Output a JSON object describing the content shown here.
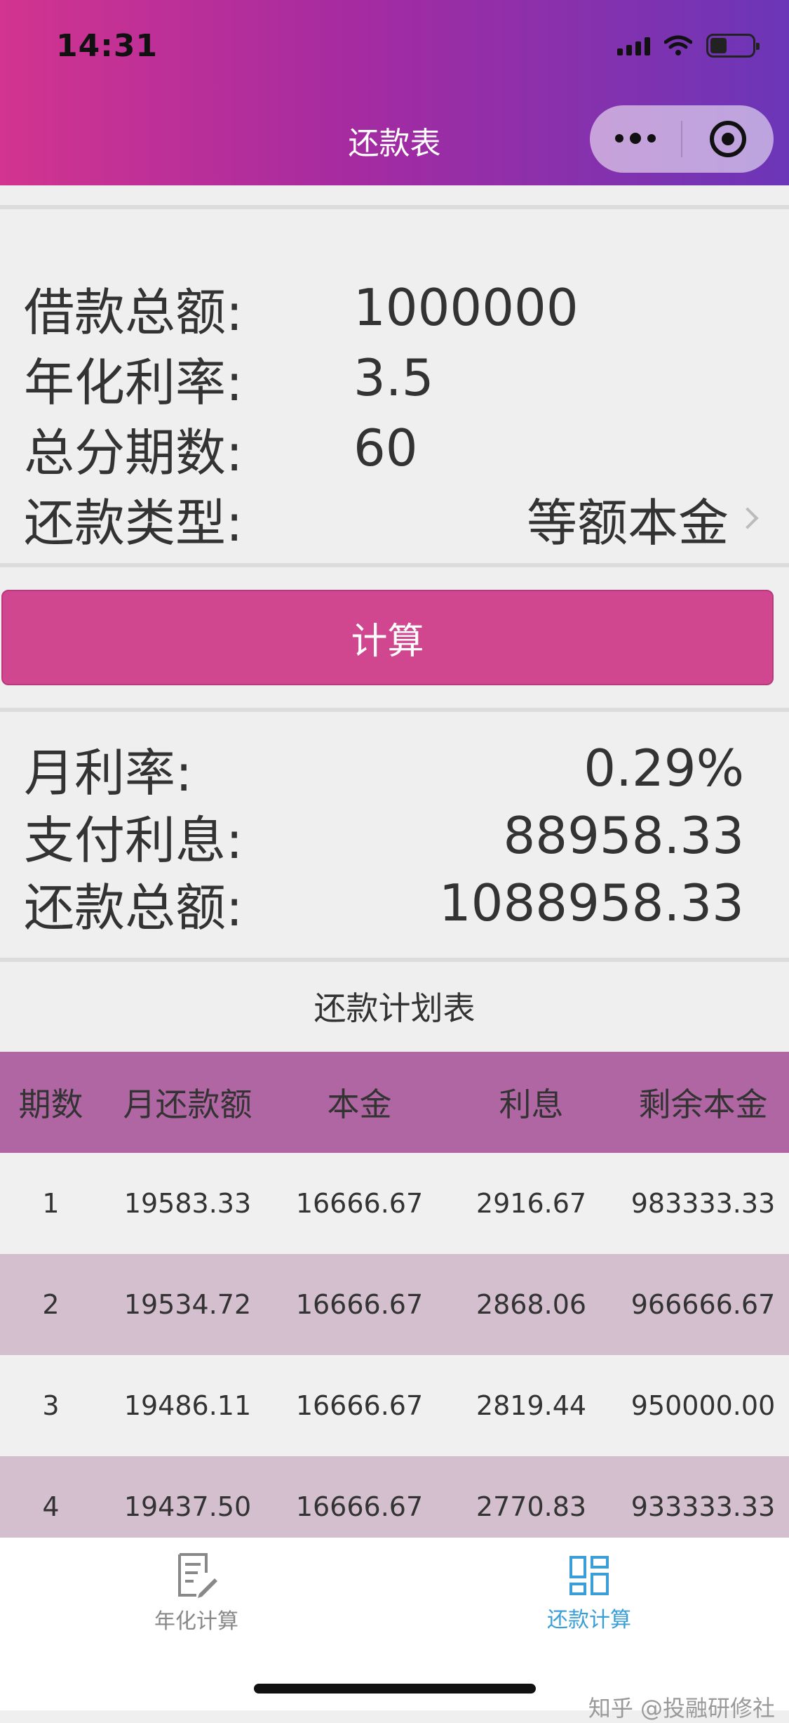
{
  "status_bar": {
    "time": "14:31"
  },
  "nav": {
    "title": "还款表"
  },
  "form": {
    "loan_amount_label": "借款总额:",
    "loan_amount_value": "1000000",
    "annual_rate_label": "年化利率:",
    "annual_rate_value": "3.5",
    "periods_label": "总分期数:",
    "periods_value": "60",
    "repay_type_label": "还款类型:",
    "repay_type_value": "等额本金"
  },
  "calculate_button": "计算",
  "results": {
    "monthly_rate_label": "月利率:",
    "monthly_rate_value": "0.29%",
    "interest_label": "支付利息:",
    "interest_value": "88958.33",
    "total_label": "还款总额:",
    "total_value": "1088958.33"
  },
  "schedule": {
    "title": "还款计划表",
    "headers": [
      "期数",
      "月还款额",
      "本金",
      "利息",
      "剩余本金"
    ],
    "rows": [
      [
        "1",
        "19583.33",
        "16666.67",
        "2916.67",
        "983333.33"
      ],
      [
        "2",
        "19534.72",
        "16666.67",
        "2868.06",
        "966666.67"
      ],
      [
        "3",
        "19486.11",
        "16666.67",
        "2819.44",
        "950000.00"
      ],
      [
        "4",
        "19437.50",
        "16666.67",
        "2770.83",
        "933333.33"
      ]
    ]
  },
  "tabbar": {
    "tab1_label": "年化计算",
    "tab2_label": "还款计算"
  },
  "watermark": "知乎 @投融研修社",
  "colors": {
    "header_gradient_start": "#d2348f",
    "header_gradient_end": "#6b36b8",
    "button": "#d0468f",
    "table_header": "#b066a2",
    "table_alt_row": "#d3bfcd",
    "tab_active": "#3a9ed8"
  }
}
